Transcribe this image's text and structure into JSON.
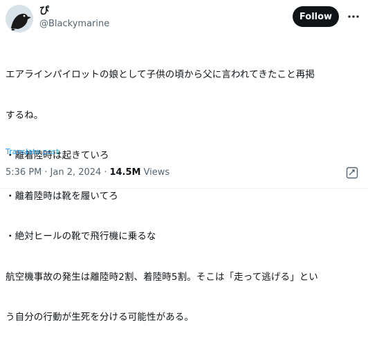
{
  "author": {
    "display_name": "ぴ",
    "handle": "@Blackymarine",
    "avatar_icon": "crow-avatar-icon"
  },
  "follow_button": {
    "label": "Follow"
  },
  "more_button": {
    "icon": "more-horizontal-icon"
  },
  "tweet": {
    "lines": [
      "エアラインパイロットの娘として子供の頃から父に言われてきたこと再掲",
      "するね。",
      "・離着陸時は起きていろ",
      "・離着陸時は靴を履いてろ",
      "・絶対ヒールの靴で飛行機に乗るな",
      "航空機事故の発生は離陸時2割、着陸時5割。そこは「走って逃げる」とい",
      "う自分の行動が生死を分ける可能性がある。"
    ]
  },
  "translate_link": "Translate post",
  "meta": {
    "time": "5:36 PM",
    "separator": "·",
    "date": "Jan 2, 2024",
    "views_count": "14.5M",
    "views_label": "Views"
  },
  "grok_icon": "grok-icon",
  "colors": {
    "text": "#0f1419",
    "secondary": "#536471",
    "link": "#1d9bf0",
    "button_bg": "#0f1419"
  }
}
